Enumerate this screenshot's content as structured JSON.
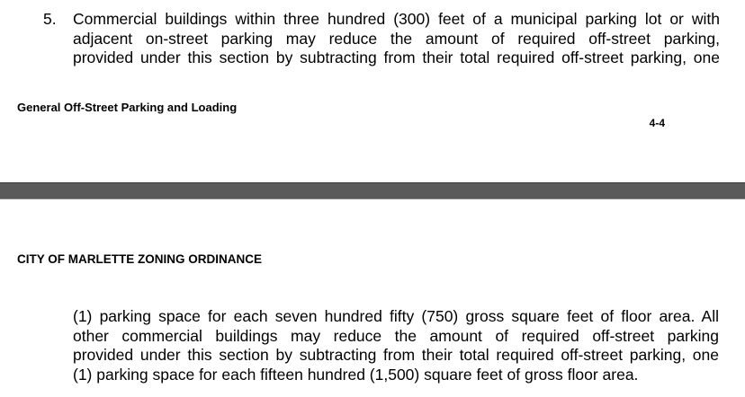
{
  "top_page": {
    "list_item": {
      "number": "5.",
      "lines": [
        "Commercial buildings within three hundred (300) feet of a municipal parking lot or with",
        "adjacent on-street parking may reduce the amount of required off-street parking,",
        "provided under this section by subtracting from their total required off-street parking, one"
      ]
    },
    "footer": {
      "section_title": "General Off-Street Parking and Loading",
      "page_number": "4-4"
    }
  },
  "bottom_page": {
    "header": {
      "title": "CITY OF MARLETTE ZONING ORDINANCE"
    },
    "continuation_lines": [
      "(1) parking space for each seven hundred fifty (750) gross square feet of floor area.  All",
      "other commercial buildings may reduce the amount of required off-street parking",
      "provided under this section by subtracting from their total required off-street parking, one",
      "(1) parking space for each fifteen hundred (1,500) square feet of gross floor area."
    ]
  },
  "colors": {
    "page_background": "#ffffff",
    "page_gap": "#5a5a5a",
    "text": "#000000"
  }
}
